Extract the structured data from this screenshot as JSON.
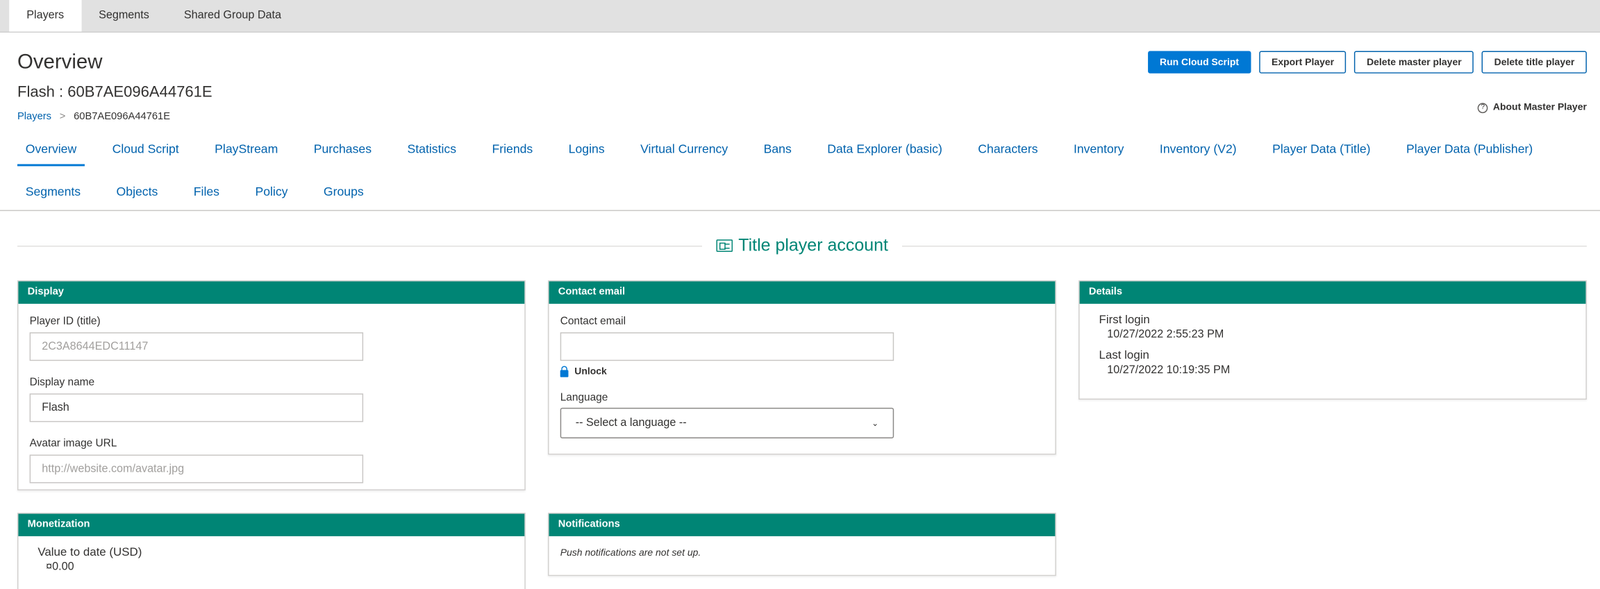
{
  "top_tabs": [
    "Players",
    "Segments",
    "Shared Group Data"
  ],
  "header": {
    "title": "Overview",
    "player_name": "Flash : 60B7AE096A44761E",
    "breadcrumb_root": "Players",
    "breadcrumb_separator": ">",
    "breadcrumb_current": "60B7AE096A44761E",
    "about_icon": "?",
    "about_link": "About Master Player"
  },
  "actions": {
    "run_cloud_script": "Run Cloud Script",
    "export_player": "Export Player",
    "delete_master": "Delete master player",
    "delete_title": "Delete title player"
  },
  "subnav": {
    "row1": [
      "Overview",
      "Cloud Script",
      "PlayStream",
      "Purchases",
      "Statistics",
      "Friends",
      "Logins",
      "Virtual Currency",
      "Bans",
      "Data Explorer (basic)",
      "Characters",
      "Inventory",
      "Inventory (V2)",
      "Player Data (Title)",
      "Player Data (Publisher)"
    ],
    "row2": [
      "Segments",
      "Objects",
      "Files",
      "Policy",
      "Groups"
    ]
  },
  "section": {
    "title": "Title player account",
    "icon": "contact-card-icon"
  },
  "display_panel": {
    "heading": "Display",
    "player_id_label": "Player ID (title)",
    "player_id_value": "2C3A8644EDC11147",
    "display_name_label": "Display name",
    "display_name_value": "Flash",
    "avatar_label": "Avatar image URL",
    "avatar_placeholder": "http://website.com/avatar.jpg"
  },
  "contact_panel": {
    "heading": "Contact email",
    "email_label": "Contact email",
    "email_value": "",
    "unlock_label": "Unlock",
    "language_label": "Language",
    "language_selected": "-- Select a language --",
    "dropdown_icon": "⌄"
  },
  "details_panel": {
    "heading": "Details",
    "first_login_label": "First login",
    "first_login_value": "10/27/2022 2:55:23 PM",
    "last_login_label": "Last login",
    "last_login_value": "10/27/2022 10:19:35 PM"
  },
  "monetization_panel": {
    "heading": "Monetization",
    "value_label": "Value to date (USD)",
    "value": "¤0.00"
  },
  "notifications_panel": {
    "heading": "Notifications",
    "note": "Push notifications are not set up."
  },
  "colors": {
    "accent": "#008575",
    "link": "#0062ad",
    "primary_button": "#0078d4"
  }
}
